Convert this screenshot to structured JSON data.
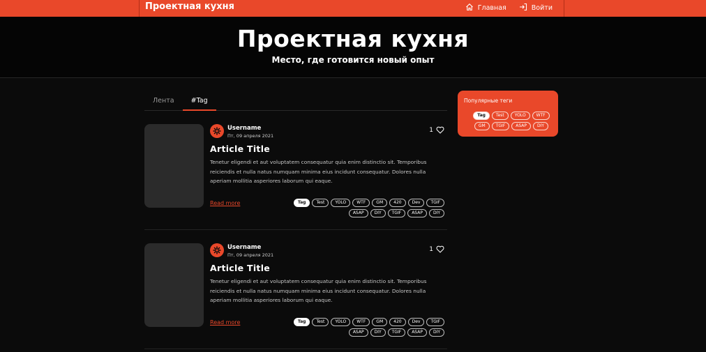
{
  "header": {
    "brand": "Проектная кухня",
    "nav": [
      {
        "label": "Главная",
        "icon": "home-icon"
      },
      {
        "label": "Войти",
        "icon": "login-icon"
      }
    ]
  },
  "hero": {
    "title": "Проектная кухня",
    "subtitle": "Место, где готовится новый опыт"
  },
  "tabs": [
    "Лента",
    "#Tag"
  ],
  "active_tab": "#Tag",
  "sidebar": {
    "title": "Популярные теги",
    "tags": [
      "Tag",
      "Test",
      "YOLO",
      "WTF",
      "GM",
      "TGIF",
      "ASAP",
      "DIY"
    ]
  },
  "posts": [
    {
      "username": "Username",
      "date": "Пт, 09 апреля 2021",
      "likes": "1",
      "title": "Article Title",
      "excerpt": "Tenetur eligendi et aut voluptatem consequatur quia enim distinctio sit. Temporibus reiciendis et nulla natus numquam minima eius incidunt consequatur. Dolores nulla aperiam mollitia asperiores laborum qui eaque.",
      "read_more": "Read more",
      "tags": [
        "Tag",
        "Test",
        "YOLO",
        "WTF",
        "GM",
        "420",
        "Dev",
        "TGIF",
        "ASAP",
        "DIY",
        "TGIF",
        "ASAP",
        "DIY"
      ]
    },
    {
      "username": "Username",
      "date": "Пт, 09 апреля 2021",
      "likes": "1",
      "title": "Article Title",
      "excerpt": "Tenetur eligendi et aut voluptatem consequatur quia enim distinctio sit. Temporibus reiciendis et nulla natus numquam minima eius incidunt consequatur. Dolores nulla aperiam mollitia asperiores laborum qui eaque.",
      "read_more": "Read more",
      "tags": [
        "Tag",
        "Test",
        "YOLO",
        "WTF",
        "GM",
        "420",
        "Dev",
        "TGIF",
        "ASAP",
        "DIY",
        "TGIF",
        "ASAP",
        "DIY"
      ]
    }
  ],
  "colors": {
    "accent": "#e9482a",
    "background": "#0b0b0b",
    "thumb": "#2b2b2b"
  }
}
